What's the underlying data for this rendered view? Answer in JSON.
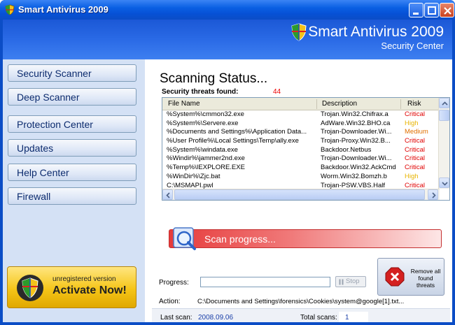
{
  "window": {
    "title": "Smart Antivirus 2009"
  },
  "header": {
    "title": "Smart Antivirus 2009",
    "subtitle": "Security Center"
  },
  "sidebar": {
    "items": [
      {
        "label": "Security Scanner"
      },
      {
        "label": "Deep Scanner"
      },
      {
        "label": "Protection Center"
      },
      {
        "label": "Updates"
      },
      {
        "label": "Help Center"
      },
      {
        "label": "Firewall"
      }
    ],
    "activate": {
      "small": "unregistered version",
      "big": "Activate Now!"
    }
  },
  "main": {
    "title": "Scanning Status...",
    "threats_label": "Security threats found:",
    "threats_count": "44",
    "columns": [
      "File Name",
      "Description",
      "Risk"
    ],
    "rows": [
      {
        "file": "%System%\\cmmon32.exe",
        "desc": "Trojan.Win32.Chifrax.a",
        "risk": "Critical"
      },
      {
        "file": "%System%\\Servere.exe",
        "desc": "AdWare.Win32.BHO.ca",
        "risk": "High"
      },
      {
        "file": "%Documents and Settings%\\Application Data...",
        "desc": "Trojan-Downloader.Wi...",
        "risk": "Medium"
      },
      {
        "file": "%User Profile%\\Local Settings\\Temp\\ally.exe",
        "desc": "Trojan-Proxy.Win32.B...",
        "risk": "Critical"
      },
      {
        "file": "%System%\\windata.exe",
        "desc": "Backdoor.Netbus",
        "risk": "Critical"
      },
      {
        "file": "%Windir%\\jammer2nd.exe",
        "desc": "Trojan-Downloader.Wi...",
        "risk": "Critical"
      },
      {
        "file": "%Temp%\\IEXPLORE.EXE",
        "desc": "Backdoor.Win32.AckCmd",
        "risk": "Critical"
      },
      {
        "file": "%WinDir%\\Zjc.bat",
        "desc": "Worm.Win32.Bomzh.b",
        "risk": "High"
      },
      {
        "file": "C:\\MSMAPI.pwl",
        "desc": "Trojan-PSW.VBS.Half",
        "risk": "Critical"
      }
    ],
    "risk_colors": {
      "Critical": "#e00000",
      "High": "#e8b400",
      "Medium": "#e07000"
    },
    "scan_progress_label": "Scan progress...",
    "remove_button": "Remove all found threats",
    "progress_label": "Progress:",
    "stop_label": "Stop",
    "action_label": "Action:",
    "action_value": "C:\\Documents and Settings\\forensics\\Cookies\\system@google[1].txt...",
    "last_scan_label": "Last scan:",
    "last_scan_value": "2008.09.06",
    "total_scans_label": "Total scans:",
    "total_scans_value": "1"
  }
}
